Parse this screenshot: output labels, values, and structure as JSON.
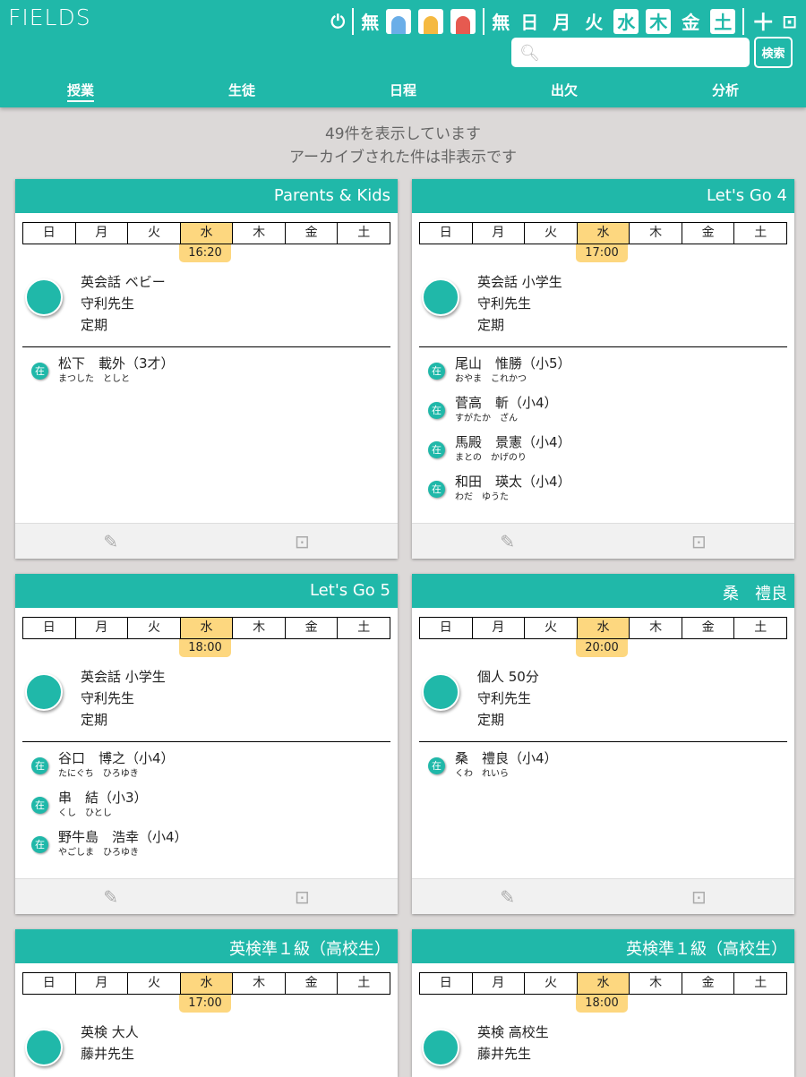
{
  "app": {
    "logo": "FIELDS"
  },
  "toolbar": {
    "none1": "無",
    "none2": "無",
    "days": [
      "日",
      "月",
      "火",
      "水",
      "木",
      "金",
      "土"
    ],
    "active_days": [
      "水",
      "木",
      "土"
    ],
    "search_placeholder": "",
    "search_button": "検索"
  },
  "nav": [
    "授業",
    "生徒",
    "日程",
    "出欠",
    "分析"
  ],
  "info": {
    "count": "49件を表示しています",
    "archived": "アーカイブされた件は非表示です"
  },
  "week": [
    "日",
    "月",
    "火",
    "水",
    "木",
    "金",
    "土"
  ],
  "status_badge": "在",
  "cards": [
    {
      "title": "Parents & Kids",
      "time": "16:20",
      "course": "英会話 ベビー",
      "teacher": "守利先生",
      "type": "定期",
      "students": [
        {
          "name": "松下　載外（3才）",
          "kana": "まつした　としと"
        }
      ]
    },
    {
      "title": "Let's Go 4",
      "time": "17:00",
      "course": "英会話 小学生",
      "teacher": "守利先生",
      "type": "定期",
      "students": [
        {
          "name": "尾山　惟勝（小5）",
          "kana": "おやま　これかつ"
        },
        {
          "name": "菅高　斬（小4）",
          "kana": "すがたか　ざん"
        },
        {
          "name": "馬殿　景憲（小4）",
          "kana": "まとの　かげのり"
        },
        {
          "name": "和田　瑛太（小4）",
          "kana": "わだ　ゆうた"
        }
      ]
    },
    {
      "title": "Let's Go 5",
      "time": "18:00",
      "course": "英会話 小学生",
      "teacher": "守利先生",
      "type": "定期",
      "students": [
        {
          "name": "谷口　博之（小4）",
          "kana": "たにぐち　ひろゆき"
        },
        {
          "name": "串　結（小3）",
          "kana": "くし　ひとし"
        },
        {
          "name": "野牛島　浩幸（小4）",
          "kana": "やごしま　ひろゆき"
        }
      ]
    },
    {
      "title": "桑　禮良",
      "time": "20:00",
      "course": "個人 50分",
      "teacher": "守利先生",
      "type": "定期",
      "students": [
        {
          "name": "桑　禮良（小4）",
          "kana": "くわ　れいら"
        }
      ]
    },
    {
      "title": "英検準１級（高校生）",
      "time": "17:00",
      "course": "英検 大人",
      "teacher": "藤井先生",
      "type": "",
      "students": []
    },
    {
      "title": "英検準１級（高校生）",
      "time": "18:00",
      "course": "英検 高校生",
      "teacher": "藤井先生",
      "type": "",
      "students": []
    }
  ]
}
